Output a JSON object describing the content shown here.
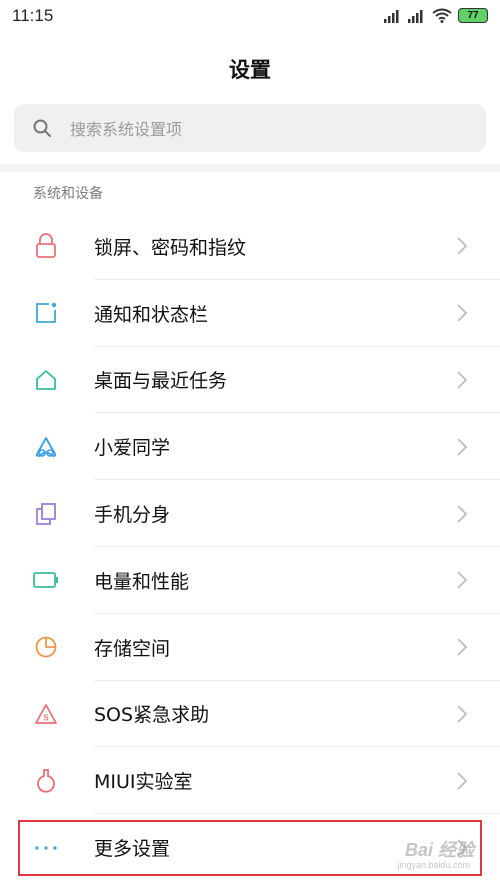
{
  "status": {
    "time": "11:15",
    "battery": "77"
  },
  "page": {
    "title": "设置"
  },
  "search": {
    "placeholder": "搜索系统设置项"
  },
  "section": {
    "title": "系统和设备"
  },
  "items": [
    {
      "label": "锁屏、密码和指纹",
      "icon": "lock-icon",
      "color": "#e8707a"
    },
    {
      "label": "通知和状态栏",
      "icon": "notification-icon",
      "color": "#3fa7d8"
    },
    {
      "label": "桌面与最近任务",
      "icon": "home-icon",
      "color": "#3dbb9a"
    },
    {
      "label": "小爱同学",
      "icon": "xiaoai-icon",
      "color": "#3a9ee6"
    },
    {
      "label": "手机分身",
      "icon": "dual-phone-icon",
      "color": "#9b7fd6"
    },
    {
      "label": "电量和性能",
      "icon": "battery-icon",
      "color": "#3dbb9a"
    },
    {
      "label": "存储空间",
      "icon": "storage-pie-icon",
      "color": "#f0934a"
    },
    {
      "label": "SOS紧急求助",
      "icon": "sos-icon",
      "color": "#e8707a"
    },
    {
      "label": "MIUI实验室",
      "icon": "lab-flask-icon",
      "color": "#e8707a"
    },
    {
      "label": "更多设置",
      "icon": "more-dots-icon",
      "color": "#3a9ee6"
    }
  ],
  "watermark": {
    "text": "Bai 经验",
    "sub": "jingyan.baidu.com"
  }
}
